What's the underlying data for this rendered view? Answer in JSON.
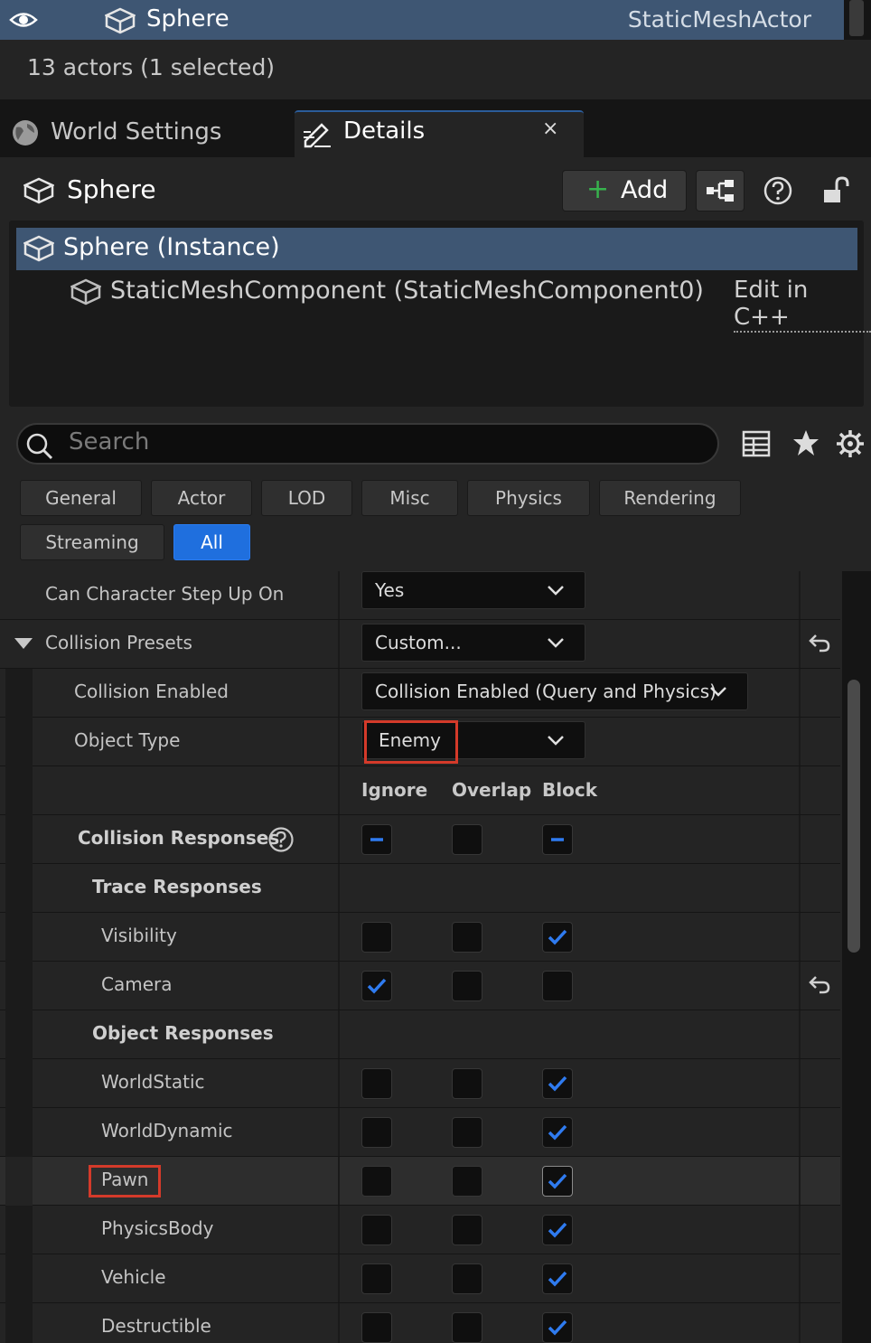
{
  "outliner": {
    "selected_name": "Sphere",
    "selected_type": "StaticMeshActor",
    "status": "13 actors (1 selected)"
  },
  "tabs": {
    "world_settings": "World Settings",
    "details": "Details",
    "close": "×"
  },
  "details": {
    "actor_name": "Sphere",
    "add_label": "Add",
    "components": {
      "root": "Sphere (Instance)",
      "child": "StaticMeshComponent (StaticMeshComponent0)",
      "edit_link": "Edit in C++"
    },
    "search_placeholder": "Search",
    "filters": [
      "General",
      "Actor",
      "LOD",
      "Misc",
      "Physics",
      "Rendering",
      "Streaming",
      "All"
    ],
    "active_filter": "All"
  },
  "properties": {
    "can_step_up": {
      "label": "Can Character Step Up On",
      "value": "Yes"
    },
    "collision_presets": {
      "label": "Collision Presets",
      "value": "Custom..."
    },
    "collision_enabled": {
      "label": "Collision Enabled",
      "value": "Collision Enabled (Query and Physics)"
    },
    "object_type": {
      "label": "Object Type",
      "value": "Enemy"
    },
    "columns": [
      "Ignore",
      "Overlap",
      "Block"
    ],
    "collision_responses_label": "Collision Responses",
    "trace_responses_label": "Trace Responses",
    "object_responses_label": "Object Responses",
    "trace_channels": [
      {
        "name": "Visibility",
        "state": "Block"
      },
      {
        "name": "Camera",
        "state": "Ignore"
      }
    ],
    "object_channels": [
      {
        "name": "WorldStatic",
        "state": "Block"
      },
      {
        "name": "WorldDynamic",
        "state": "Block"
      },
      {
        "name": "Pawn",
        "state": "Block"
      },
      {
        "name": "PhysicsBody",
        "state": "Block"
      },
      {
        "name": "Vehicle",
        "state": "Block"
      },
      {
        "name": "Destructible",
        "state": "Block"
      }
    ]
  },
  "colors": {
    "selection": "#3e5673",
    "accent_blue": "#1f6fde",
    "check_blue": "#2f7bf0",
    "highlight_red": "#d43a2a",
    "add_green": "#37b24d"
  }
}
